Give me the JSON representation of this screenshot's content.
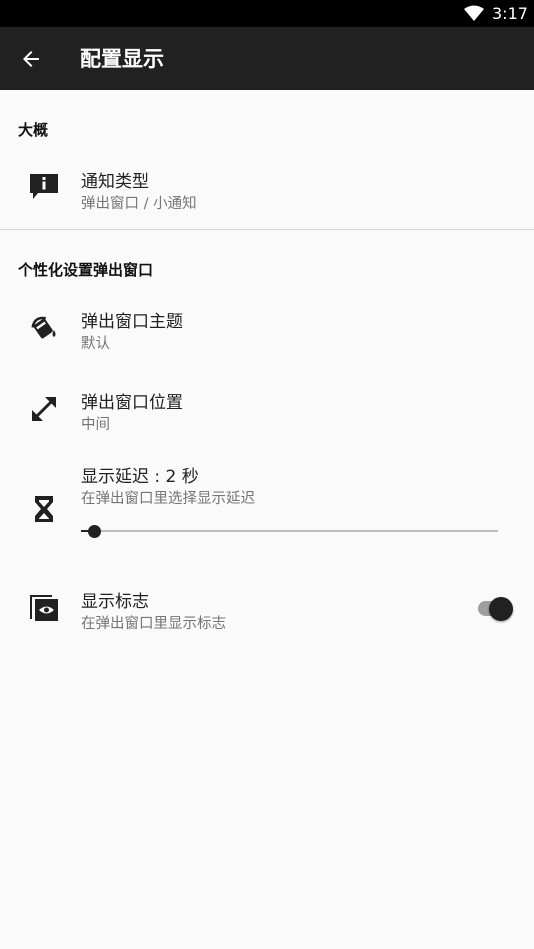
{
  "status_bar": {
    "time": "3:17",
    "wifi_icon": "wifi-icon"
  },
  "app_bar": {
    "title": "配置显示",
    "back_icon": "arrow-back-icon"
  },
  "sections": {
    "general": {
      "header": "大概",
      "notification_type": {
        "title": "通知类型",
        "summary": "弹出窗口 / 小通知",
        "icon": "info-message-icon"
      }
    },
    "personalize": {
      "header": "个性化设置弹出窗口",
      "theme": {
        "title": "弹出窗口主题",
        "summary": "默认",
        "icon": "paint-bucket-icon"
      },
      "position": {
        "title": "弹出窗口位置",
        "summary": "中间",
        "icon": "expand-arrows-icon"
      },
      "delay": {
        "title": "显示延迟 : 2 秒",
        "summary": "在弹出窗口里选择显示延迟",
        "icon": "hourglass-icon",
        "value_seconds": 2,
        "slider_fraction": 0.02
      },
      "show_icon": {
        "title": "显示标志",
        "summary": "在弹出窗口里显示标志",
        "icon": "eye-window-icon",
        "enabled": true
      }
    }
  },
  "colors": {
    "app_bar": "#212121",
    "background": "#fafafa",
    "accent": "#212121"
  }
}
